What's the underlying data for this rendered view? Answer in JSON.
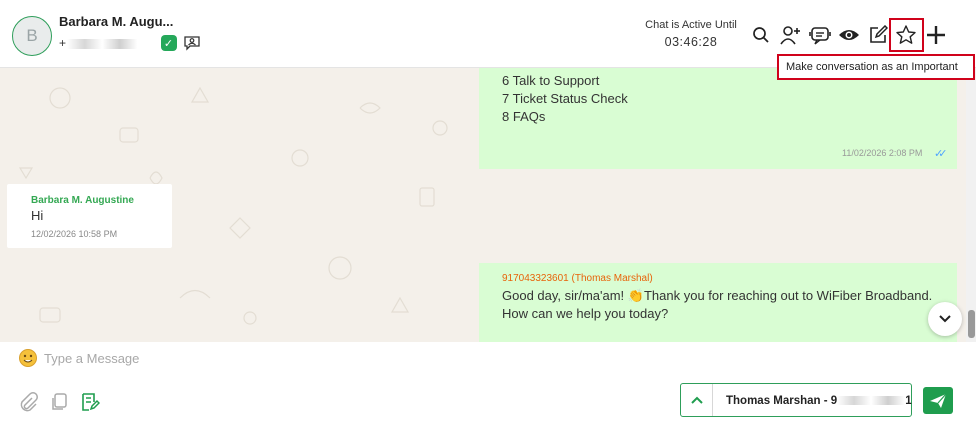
{
  "header": {
    "avatar_initial": "B",
    "contact_name": "Barbara M. Augu...",
    "phone_visible": "+",
    "active_label": "Chat is Active Until",
    "active_time": "03:46:28",
    "tooltip": "Make conversation as an Important",
    "icons": [
      "search-icon",
      "add-user-icon",
      "bot-icon",
      "eye-icon",
      "edit-icon",
      "star-icon",
      "plus-icon"
    ]
  },
  "messages": [
    {
      "direction": "outgoing",
      "lines": [
        "6 Talk to Support",
        "7 Ticket Status Check",
        "8 FAQs"
      ],
      "timestamp": "11/02/2026 2:08 PM",
      "status": "read"
    },
    {
      "direction": "incoming",
      "sender": "Barbara M. Augustine",
      "text": "Hi",
      "timestamp": "12/02/2026 10:58 PM"
    },
    {
      "direction": "outgoing",
      "sender": "917043323601 (Thomas Marshal)",
      "text": "Good day, sir/ma'am! 👏Thank you for reaching out to WiFiber Broadband. How can we help you today?"
    }
  ],
  "composer": {
    "placeholder": "Type a Message",
    "agent_label": "Thomas Marshan - 9",
    "agent_suffix": "1"
  },
  "colors": {
    "accent": "#1f9d4e",
    "outgoing_bubble": "#d9fdd3",
    "chat_bg": "#f4f0ea",
    "highlight": "#d0021b",
    "sender_orange": "#e8630a",
    "incoming_name": "#34a853"
  }
}
